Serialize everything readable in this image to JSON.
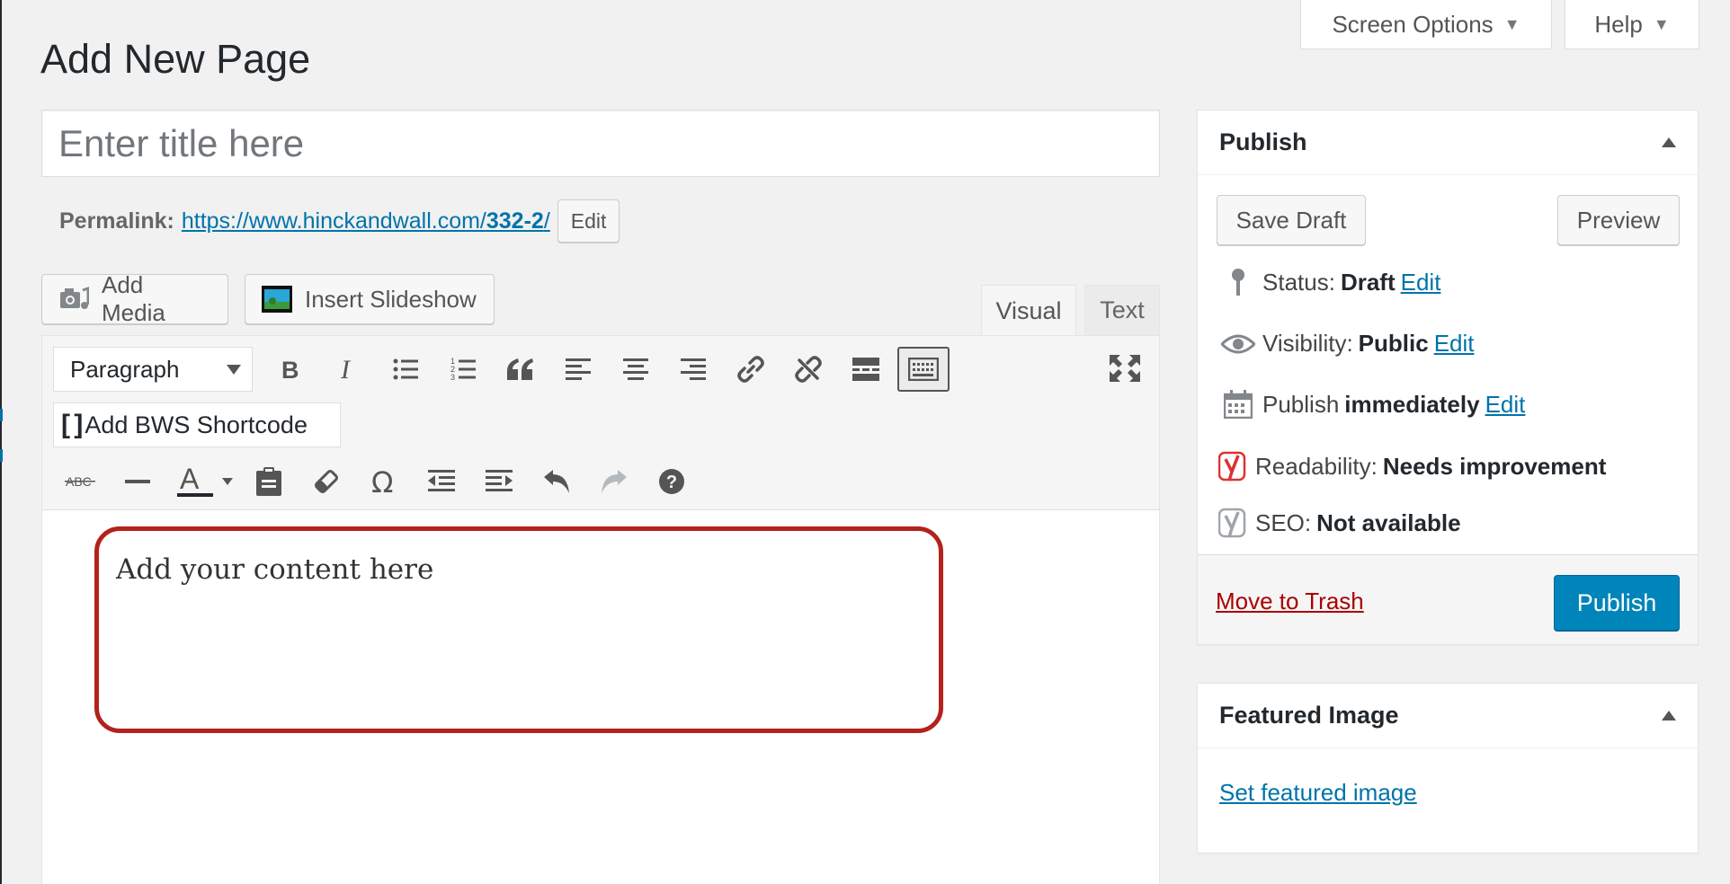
{
  "screen_meta": {
    "screen_options_label": "Screen Options",
    "help_label": "Help",
    "dropdown_glyph": "▼"
  },
  "page_title": "Add New Page",
  "title_input": {
    "placeholder": "Enter title here",
    "value": ""
  },
  "permalink": {
    "label": "Permalink:",
    "url_base": "https://www.hinckandwall.com/",
    "slug": "332-2",
    "trailing": "/",
    "edit_label": "Edit"
  },
  "media_buttons": {
    "add_media": "Add Media",
    "insert_slideshow": "Insert Slideshow"
  },
  "editor_tabs": {
    "visual": "Visual",
    "text": "Text",
    "active": "visual"
  },
  "toolbar": {
    "format_select": "Paragraph",
    "bws_shortcode": "Add BWS Shortcode",
    "strikethrough_glyph": "ABC",
    "text_color_glyph": "A",
    "special_char_glyph": "Ω",
    "help_glyph": "?",
    "colors": {
      "text_color_bar": "#23282d"
    }
  },
  "content": {
    "placeholder_text": "Add your content here",
    "highlight_color": "#b3221c"
  },
  "publish_box": {
    "title": "Publish",
    "save_draft": "Save Draft",
    "preview": "Preview",
    "status": {
      "label": "Status:",
      "value": "Draft",
      "edit": "Edit"
    },
    "visibility": {
      "label": "Visibility:",
      "value": "Public",
      "edit": "Edit"
    },
    "schedule": {
      "label": "Publish",
      "value": "immediately",
      "edit": "Edit"
    },
    "readability": {
      "label": "Readability:",
      "value": "Needs improvement"
    },
    "seo": {
      "label": "SEO:",
      "value": "Not available"
    },
    "trash": "Move to Trash",
    "publish": "Publish"
  },
  "featured_image_box": {
    "title": "Featured Image",
    "set_link": "Set featured image"
  },
  "colors": {
    "link": "#0073aa",
    "primary": "#0085ba",
    "trash": "#a00000",
    "yoast_red": "#dc3232"
  }
}
